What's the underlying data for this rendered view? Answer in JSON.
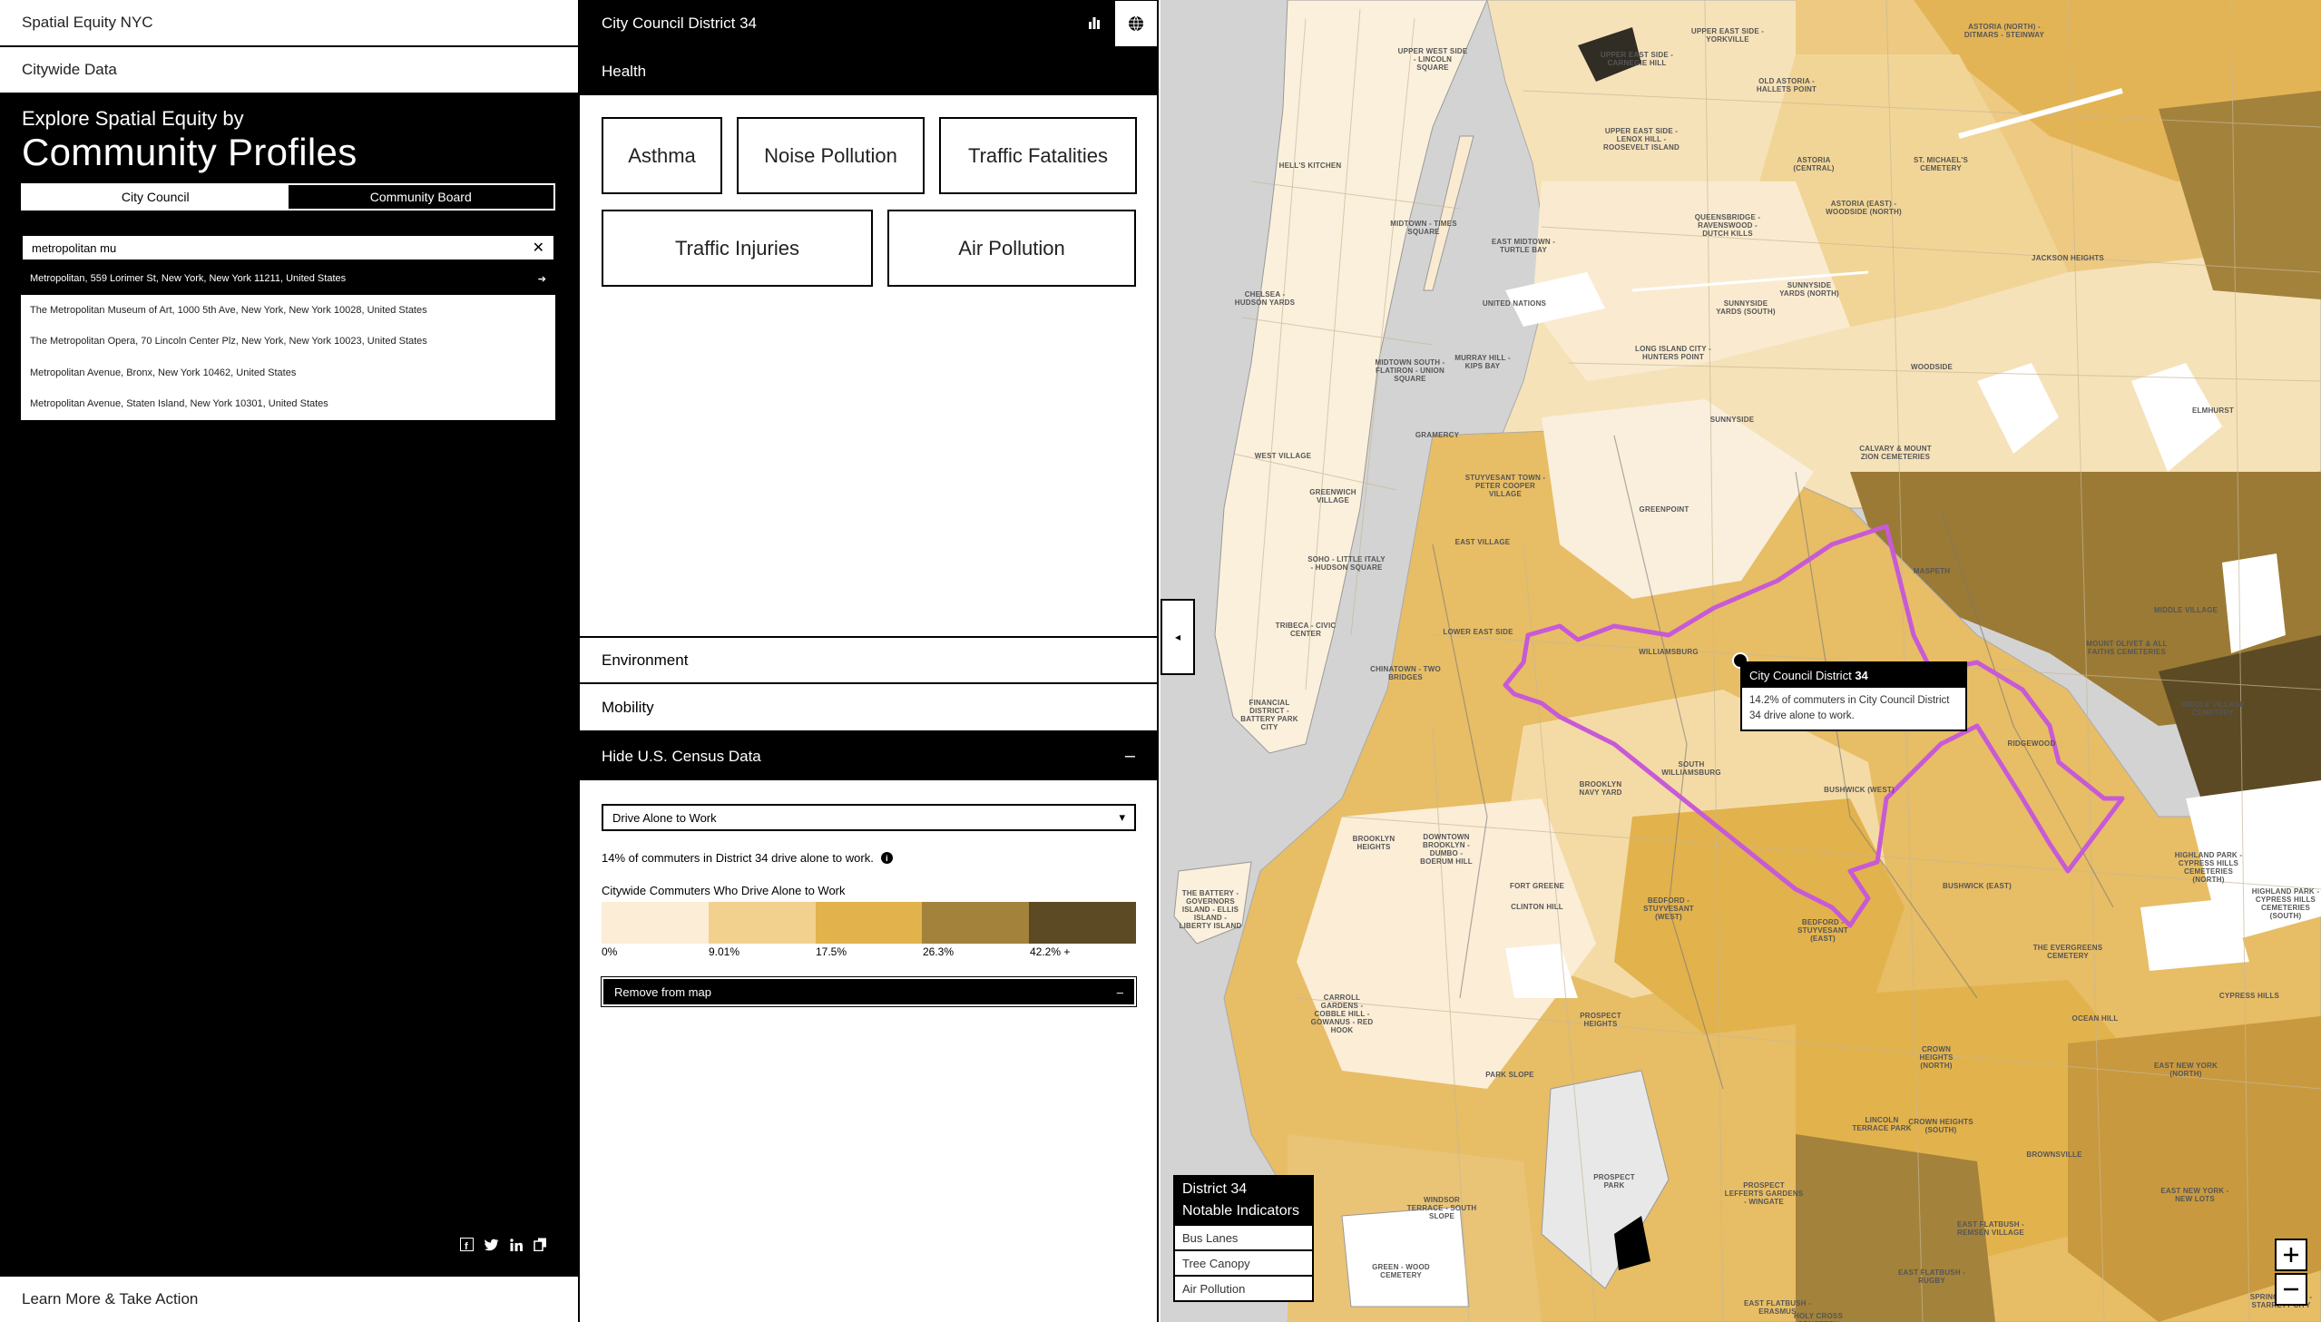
{
  "brand": "Spatial Equity NYC",
  "citywide": "Citywide Data",
  "explore": {
    "sub": "Explore Spatial Equity by",
    "title": "Community Profiles"
  },
  "toggle": {
    "city_council": "City Council",
    "community_board": "Community Board"
  },
  "search": {
    "value": "metropolitan mu",
    "clear_icon": "close-icon"
  },
  "results": [
    "Metropolitan, 559 Lorimer St, New York, New York 11211, United States",
    "The Metropolitan Museum of Art, 1000 5th Ave, New York, New York 10028, United States",
    "The Metropolitan Opera, 70 Lincoln Center Plz, New York, New York 10023, United States",
    "Metropolitan Avenue, Bronx, New York 10462, United States",
    "Metropolitan Avenue, Staten Island, New York 10301, United States"
  ],
  "learn": "Learn More & Take Action",
  "panel": {
    "title": "City Council District 34",
    "health": "Health",
    "tiles_row1": [
      "Asthma",
      "Noise Pollution",
      "Traffic Fatalities"
    ],
    "tiles_row2": [
      "Traffic Injuries",
      "Air Pollution"
    ],
    "environment": "Environment",
    "mobility": "Mobility",
    "census": "Hide U.S. Census Data",
    "census_minus": "–",
    "dropdown": "Drive Alone to Work",
    "stat": "14% of commuters in District 34 drive alone to work.",
    "legend_title": "Citywide Commuters Who Drive Alone to Work",
    "legend_colors": [
      "#fbedd6",
      "#f2d08e",
      "#e2b24c",
      "#a3823c",
      "#5c4a24"
    ],
    "legend_ticks": [
      "0%",
      "9.01%",
      "17.5%",
      "26.3%",
      "42.2% +"
    ],
    "remove": "Remove from map",
    "remove_minus": "–"
  },
  "tooltip": {
    "title_prefix": "City Council District",
    "title_num": "34",
    "body": "14.2% of commuters in City Council District 34 drive alone to work."
  },
  "notable": {
    "title1": "District 34",
    "title2": "Notable Indicators",
    "items": [
      "Bus Lanes",
      "Tree Canopy",
      "Air Pollution"
    ]
  },
  "map_labels": [
    "UPPER WEST SIDE - LINCOLN SQUARE",
    "UPPER EAST SIDE - CARNEGIE HILL",
    "UPPER EAST SIDE - YORKVILLE",
    "OLD ASTORIA - HALLETS POINT",
    "ASTORIA (NORTH) - DITMARS - STEINWAY",
    "UPPER EAST SIDE - LENOX HILL - ROOSEVELT ISLAND",
    "HELL'S KITCHEN",
    "ASTORIA (CENTRAL)",
    "ST. MICHAEL'S CEMETERY",
    "MIDTOWN - TIMES SQUARE",
    "EAST MIDTOWN - TURTLE BAY",
    "QUEENSBRIDGE - RAVENSWOOD - DUTCH KILLS",
    "ASTORIA (EAST) - WOODSIDE (NORTH)",
    "JACKSON HEIGHTS",
    "CHELSEA - HUDSON YARDS",
    "UNITED NATIONS",
    "SUNNYSIDE YARDS (SOUTH)",
    "SUNNYSIDE YARDS (NORTH)",
    "LONG ISLAND CITY - HUNTERS POINT",
    "MIDTOWN SOUTH - FLATIRON - UNION SQUARE",
    "MURRAY HILL - KIPS BAY",
    "WOODSIDE",
    "SUNNYSIDE",
    "ELMHURST",
    "WEST VILLAGE",
    "GRAMERCY",
    "CALVARY & MOUNT ZION CEMETERIES",
    "GREENWICH VILLAGE",
    "STUYVESANT TOWN - PETER COOPER VILLAGE",
    "GREENPOINT",
    "EAST VILLAGE",
    "MASPETH",
    "SOHO - LITTLE ITALY - HUDSON SQUARE",
    "MIDDLE VILLAGE",
    "TRIBECA - CIVIC CENTER",
    "LOWER EAST SIDE",
    "MOUNT OLIVET & ALL FAITHS CEMETERIES",
    "WILLIAMSBURG",
    "CHINATOWN - TWO BRIDGES",
    "MIDDLE VILLAGE CEMETERY",
    "FINANCIAL DISTRICT - BATTERY PARK CITY",
    "RIDGEWOOD",
    "SOUTH WILLIAMSBURG",
    "BUSHWICK (WEST)",
    "BROOKLYN NAVY YARD",
    "DOWNTOWN BROOKLYN - DUMBO - BOERUM HILL",
    "BROOKLYN HEIGHTS",
    "FORT GREENE",
    "HIGHLAND PARK - CYPRESS HILLS CEMETERIES (NORTH)",
    "HIGHLAND PARK - CYPRESS HILLS CEMETERIES (SOUTH)",
    "BUSHWICK (EAST)",
    "THE BATTERY - GOVERNORS ISLAND - ELLIS ISLAND - LIBERTY ISLAND",
    "CLINTON HILL",
    "BEDFORD - STUYVESANT (WEST)",
    "BEDFORD - STUYVESANT (EAST)",
    "THE EVERGREENS CEMETERY",
    "CYPRESS HILLS",
    "OCEAN HILL",
    "CARROLL GARDENS - COBBLE HILL - GOWANUS - RED HOOK",
    "PROSPECT HEIGHTS",
    "CROWN HEIGHTS (NORTH)",
    "EAST NEW YORK (NORTH)",
    "PARK SLOPE",
    "LINCOLN TERRACE PARK",
    "BROWNSVILLE",
    "CROWN HEIGHTS (SOUTH)",
    "PROSPECT LEFFERTS GARDENS - WINGATE",
    "PROSPECT PARK",
    "EAST FLATBUSH - REMSEN VILLAGE",
    "EAST NEW YORK - NEW LOTS",
    "WINDSOR TERRACE - SOUTH SLOPE",
    "GREEN - WOOD CEMETERY",
    "EAST FLATBUSH - ERASMUS",
    "EAST FLATBUSH - RUGBY",
    "HOLY CROSS CEMETERY",
    "SPRING CREEK - STARRETT CITY"
  ]
}
